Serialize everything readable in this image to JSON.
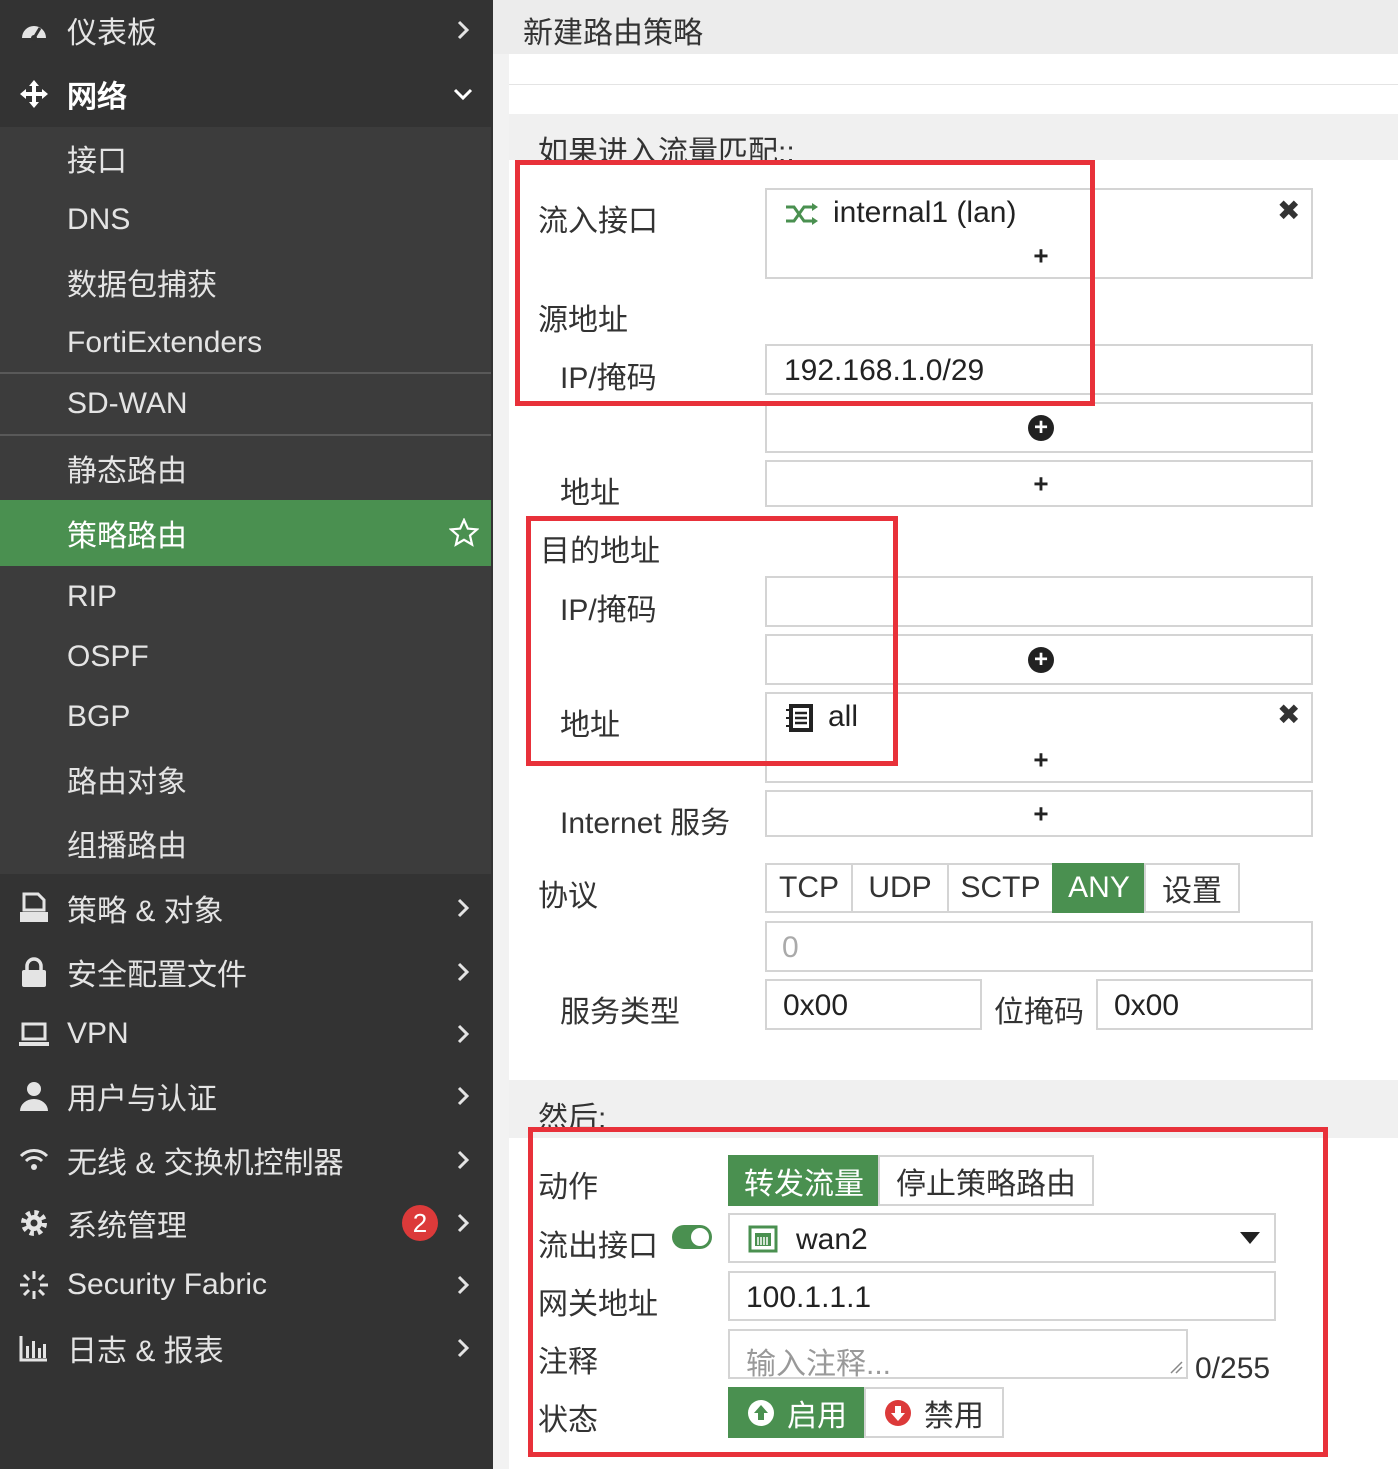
{
  "sidebar": {
    "items": [
      {
        "label": "仪表板",
        "icon": "dashboard-icon"
      },
      {
        "label": "网络",
        "icon": "network-move-icon"
      },
      {
        "label": "接口"
      },
      {
        "label": "DNS"
      },
      {
        "label": "数据包捕获"
      },
      {
        "label": "FortiExtenders"
      },
      {
        "label": "SD-WAN"
      },
      {
        "label": "静态路由"
      },
      {
        "label": "策略路由"
      },
      {
        "label": "RIP"
      },
      {
        "label": "OSPF"
      },
      {
        "label": "BGP"
      },
      {
        "label": "路由对象"
      },
      {
        "label": "组播路由"
      },
      {
        "label": "策略 & 对象",
        "icon": "policy-icon"
      },
      {
        "label": "安全配置文件",
        "icon": "lock-icon"
      },
      {
        "label": "VPN",
        "icon": "laptop-icon"
      },
      {
        "label": "用户与认证",
        "icon": "user-icon"
      },
      {
        "label": "无线 & 交换机控制器",
        "icon": "wifi-icon"
      },
      {
        "label": "系统管理",
        "icon": "gear-icon",
        "badge": "2"
      },
      {
        "label": "Security Fabric",
        "icon": "fabric-icon"
      },
      {
        "label": "日志 & 报表",
        "icon": "chart-icon"
      }
    ]
  },
  "header": {
    "title": "新建路由策略"
  },
  "match": {
    "section_label": "如果进入流量匹配::",
    "incoming_label": "流入接口",
    "incoming_value": "internal1 (lan)",
    "source_label": "源地址",
    "src_ipmask_label": "IP/掩码",
    "src_ipmask_value": "192.168.1.0/29",
    "src_address_label": "地址",
    "dest_label": "目的地址",
    "dst_ipmask_label": "IP/掩码",
    "dst_address_label": "地址",
    "dst_address_value": "all",
    "internet_service_label": "Internet 服务",
    "protocol_label": "协议",
    "protocols": [
      "TCP",
      "UDP",
      "SCTP",
      "ANY",
      "设置"
    ],
    "protocol_selected": "ANY",
    "protocol_number": "0",
    "tos_label": "服务类型",
    "tos_value": "0x00",
    "bitmask_label": "位掩码",
    "bitmask_value": "0x00"
  },
  "then": {
    "section_label": "然后:",
    "action_label": "动作",
    "action_options": [
      "转发流量",
      "停止策略路由"
    ],
    "action_selected": "转发流量",
    "outgoing_label": "流出接口",
    "outgoing_value": "wan2",
    "gateway_label": "网关地址",
    "gateway_value": "100.1.1.1",
    "comment_label": "注释",
    "comment_placeholder": "输入注释...",
    "comment_counter": "0/255",
    "status_label": "状态",
    "status_enable": "启用",
    "status_disable": "禁用"
  },
  "colors": {
    "accent": "#4a9050",
    "sidebar": "#333333",
    "highlight": "#e8313a",
    "badge": "#dc3a3a"
  }
}
